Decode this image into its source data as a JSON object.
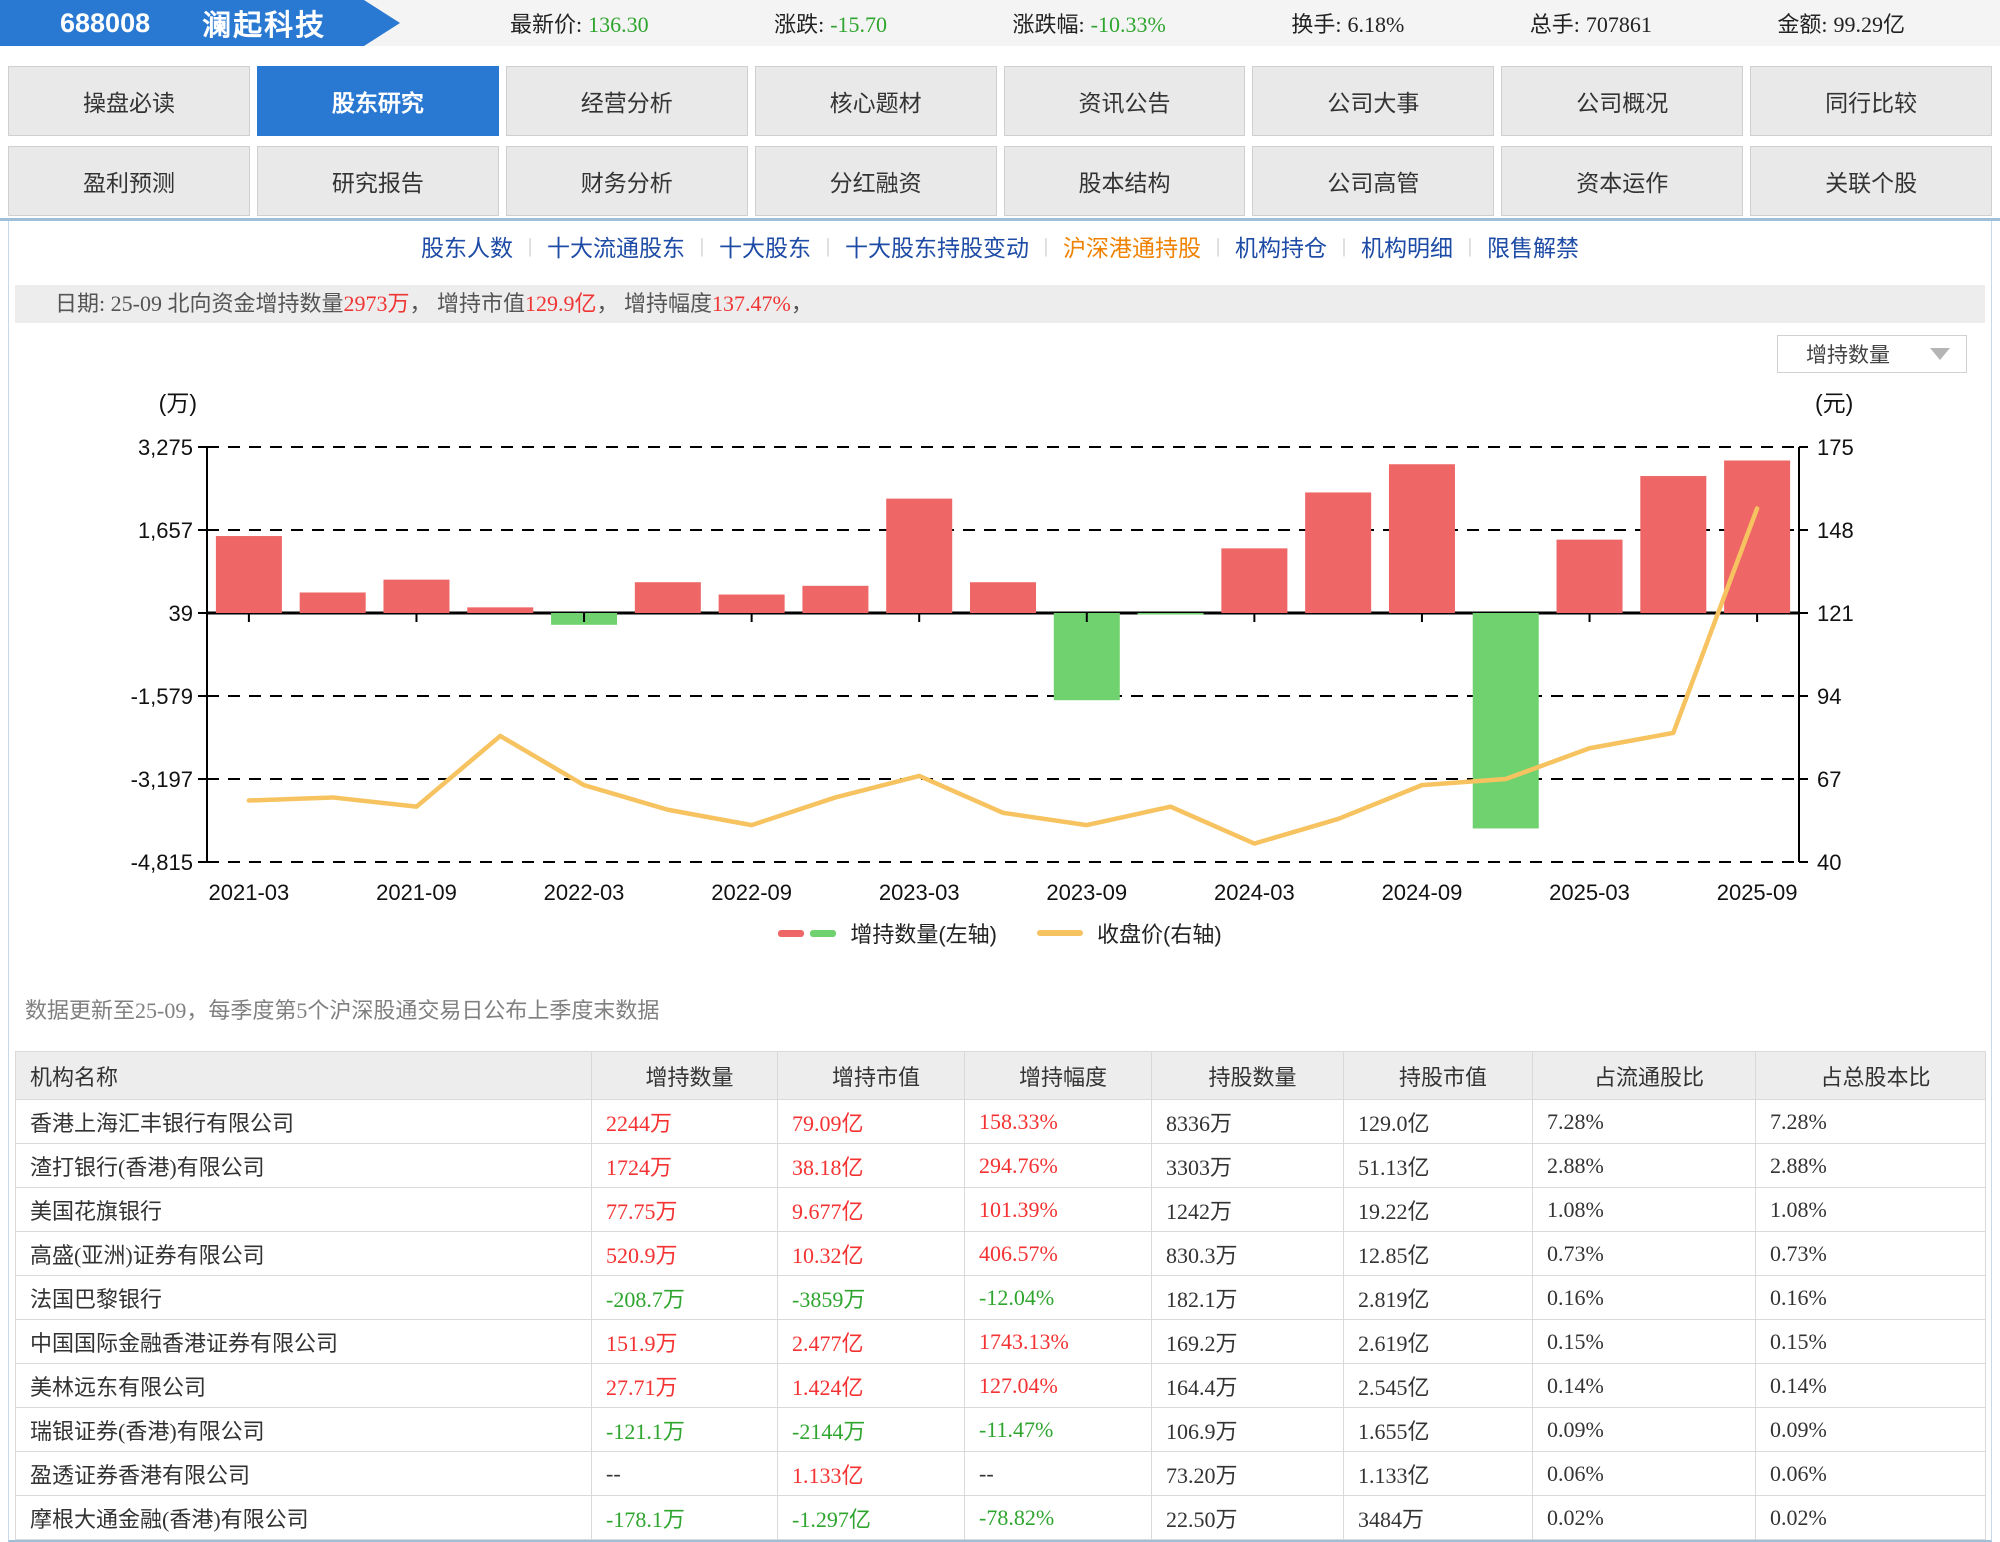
{
  "header": {
    "code": "688008",
    "name": "澜起科技",
    "stats": [
      {
        "label": "最新价:",
        "value": "136.30",
        "color": "green"
      },
      {
        "label": "涨跌:",
        "value": "-15.70",
        "color": "green"
      },
      {
        "label": "涨跌幅:",
        "value": "-10.33%",
        "color": "green"
      },
      {
        "label": "换手:",
        "value": "6.18%",
        "color": "dark"
      },
      {
        "label": "总手:",
        "value": "707861",
        "color": "dark"
      },
      {
        "label": "金额:",
        "value": "99.29亿",
        "color": "dark"
      }
    ]
  },
  "tabs": {
    "row1": [
      {
        "label": "操盘必读",
        "active": false
      },
      {
        "label": "股东研究",
        "active": true
      },
      {
        "label": "经营分析",
        "active": false
      },
      {
        "label": "核心题材",
        "active": false
      },
      {
        "label": "资讯公告",
        "active": false
      },
      {
        "label": "公司大事",
        "active": false
      },
      {
        "label": "公司概况",
        "active": false
      },
      {
        "label": "同行比较",
        "active": false
      }
    ],
    "row2": [
      {
        "label": "盈利预测",
        "active": false
      },
      {
        "label": "研究报告",
        "active": false
      },
      {
        "label": "财务分析",
        "active": false
      },
      {
        "label": "分红融资",
        "active": false
      },
      {
        "label": "股本结构",
        "active": false
      },
      {
        "label": "公司高管",
        "active": false
      },
      {
        "label": "资本运作",
        "active": false
      },
      {
        "label": "关联个股",
        "active": false
      }
    ]
  },
  "subnav": {
    "items": [
      {
        "label": "股东人数",
        "active": false
      },
      {
        "label": "十大流通股东",
        "active": false
      },
      {
        "label": "十大股东",
        "active": false
      },
      {
        "label": "十大股东持股变动",
        "active": false
      },
      {
        "label": "沪深港通持股",
        "active": true
      },
      {
        "label": "机构持仓",
        "active": false
      },
      {
        "label": "机构明细",
        "active": false
      },
      {
        "label": "限售解禁",
        "active": false
      }
    ]
  },
  "date_bar": {
    "parts": [
      {
        "text": "日期: 25-09 北向资金增持数量",
        "red": false
      },
      {
        "text": "2973万",
        "red": true
      },
      {
        "text": "， 增持市值",
        "red": false
      },
      {
        "text": "129.9亿",
        "red": true
      },
      {
        "text": "， 增持幅度",
        "red": false
      },
      {
        "text": "137.47%",
        "red": true
      },
      {
        "text": "，",
        "red": false
      }
    ]
  },
  "dropdown": {
    "label": "增持数量"
  },
  "chart_data": {
    "type": "bar+line",
    "categories": [
      "2021-03",
      "2021-06",
      "2021-09",
      "2021-12",
      "2022-03",
      "2022-06",
      "2022-09",
      "2022-12",
      "2023-03",
      "2023-06",
      "2023-09",
      "2023-12",
      "2024-03",
      "2024-06",
      "2024-09",
      "2024-12",
      "2025-03",
      "2025-06",
      "2025-09"
    ],
    "x_tick_labels": [
      "2021-03",
      "2021-09",
      "2022-03",
      "2022-09",
      "2023-03",
      "2023-09",
      "2024-03",
      "2024-09",
      "2025-03",
      "2025-09"
    ],
    "left_axis": {
      "unit": "(万)",
      "ticks": [
        3275,
        1657,
        39,
        -1579,
        -3197,
        -4815
      ],
      "tick_labels": [
        "3,275",
        "1,657",
        "39",
        "-1,579",
        "-3,197",
        "-4,815"
      ],
      "range": [
        -4815,
        3275
      ],
      "zero_value": 39
    },
    "right_axis": {
      "unit": "(元)",
      "ticks": [
        175,
        148,
        121,
        94,
        67,
        40
      ],
      "tick_labels": [
        "175",
        "148",
        "121",
        "94",
        "67",
        "40"
      ],
      "range": [
        40,
        175
      ]
    },
    "series": [
      {
        "name": "增持数量(左轴)",
        "type": "bar",
        "axis": "left",
        "values": [
          1500,
          400,
          650,
          110,
          -230,
          600,
          360,
          530,
          2230,
          600,
          -1700,
          -30,
          1260,
          2350,
          2900,
          -4200,
          1430,
          2670,
          2973
        ],
        "color_positive": "#ee6666",
        "color_negative": "#6fd26f"
      },
      {
        "name": "收盘价(右轴)",
        "type": "line",
        "axis": "right",
        "values": [
          60,
          61,
          58,
          81,
          65,
          57,
          52,
          61,
          68,
          56,
          52,
          58,
          46,
          54,
          65,
          67,
          77,
          82,
          155
        ],
        "color": "#f6c360"
      }
    ],
    "grid": "dashed-horizontal",
    "legend_position": "bottom"
  },
  "note": "数据更新至25-09，每季度第5个沪深股通交易日公布上季度末数据",
  "table": {
    "headers": [
      "机构名称",
      "增持数量",
      "增持市值",
      "增持幅度",
      "持股数量",
      "持股市值",
      "占流通股比",
      "占总股本比"
    ],
    "rows": [
      [
        "香港上海汇丰银行有限公司",
        "2244万",
        "79.09亿",
        "158.33%",
        "8336万",
        "129.0亿",
        "7.28%",
        "7.28%"
      ],
      [
        "渣打银行(香港)有限公司",
        "1724万",
        "38.18亿",
        "294.76%",
        "3303万",
        "51.13亿",
        "2.88%",
        "2.88%"
      ],
      [
        "美国花旗银行",
        "77.75万",
        "9.677亿",
        "101.39%",
        "1242万",
        "19.22亿",
        "1.08%",
        "1.08%"
      ],
      [
        "高盛(亚洲)证券有限公司",
        "520.9万",
        "10.32亿",
        "406.57%",
        "830.3万",
        "12.85亿",
        "0.73%",
        "0.73%"
      ],
      [
        "法国巴黎银行",
        "-208.7万",
        "-3859万",
        "-12.04%",
        "182.1万",
        "2.819亿",
        "0.16%",
        "0.16%"
      ],
      [
        "中国国际金融香港证券有限公司",
        "151.9万",
        "2.477亿",
        "1743.13%",
        "169.2万",
        "2.619亿",
        "0.15%",
        "0.15%"
      ],
      [
        "美林远东有限公司",
        "27.71万",
        "1.424亿",
        "127.04%",
        "164.4万",
        "2.545亿",
        "0.14%",
        "0.14%"
      ],
      [
        "瑞银证券(香港)有限公司",
        "-121.1万",
        "-2144万",
        "-11.47%",
        "106.9万",
        "1.655亿",
        "0.09%",
        "0.09%"
      ],
      [
        "盈透证券香港有限公司",
        "--",
        "1.133亿",
        "--",
        "73.20万",
        "1.133亿",
        "0.06%",
        "0.06%"
      ],
      [
        "摩根大通金融(香港)有限公司",
        "-178.1万",
        "-1.297亿",
        "-78.82%",
        "22.50万",
        "3484万",
        "0.02%",
        "0.02%"
      ]
    ]
  },
  "colors": {
    "accent_blue": "#2979d2",
    "link_blue": "#1d4ba5",
    "active_orange": "#ef8200",
    "text_red": "#f53232",
    "text_green": "#2fa52f",
    "bar_red": "#ee6666",
    "bar_green": "#6fd26f",
    "line_yellow": "#f6c360"
  }
}
